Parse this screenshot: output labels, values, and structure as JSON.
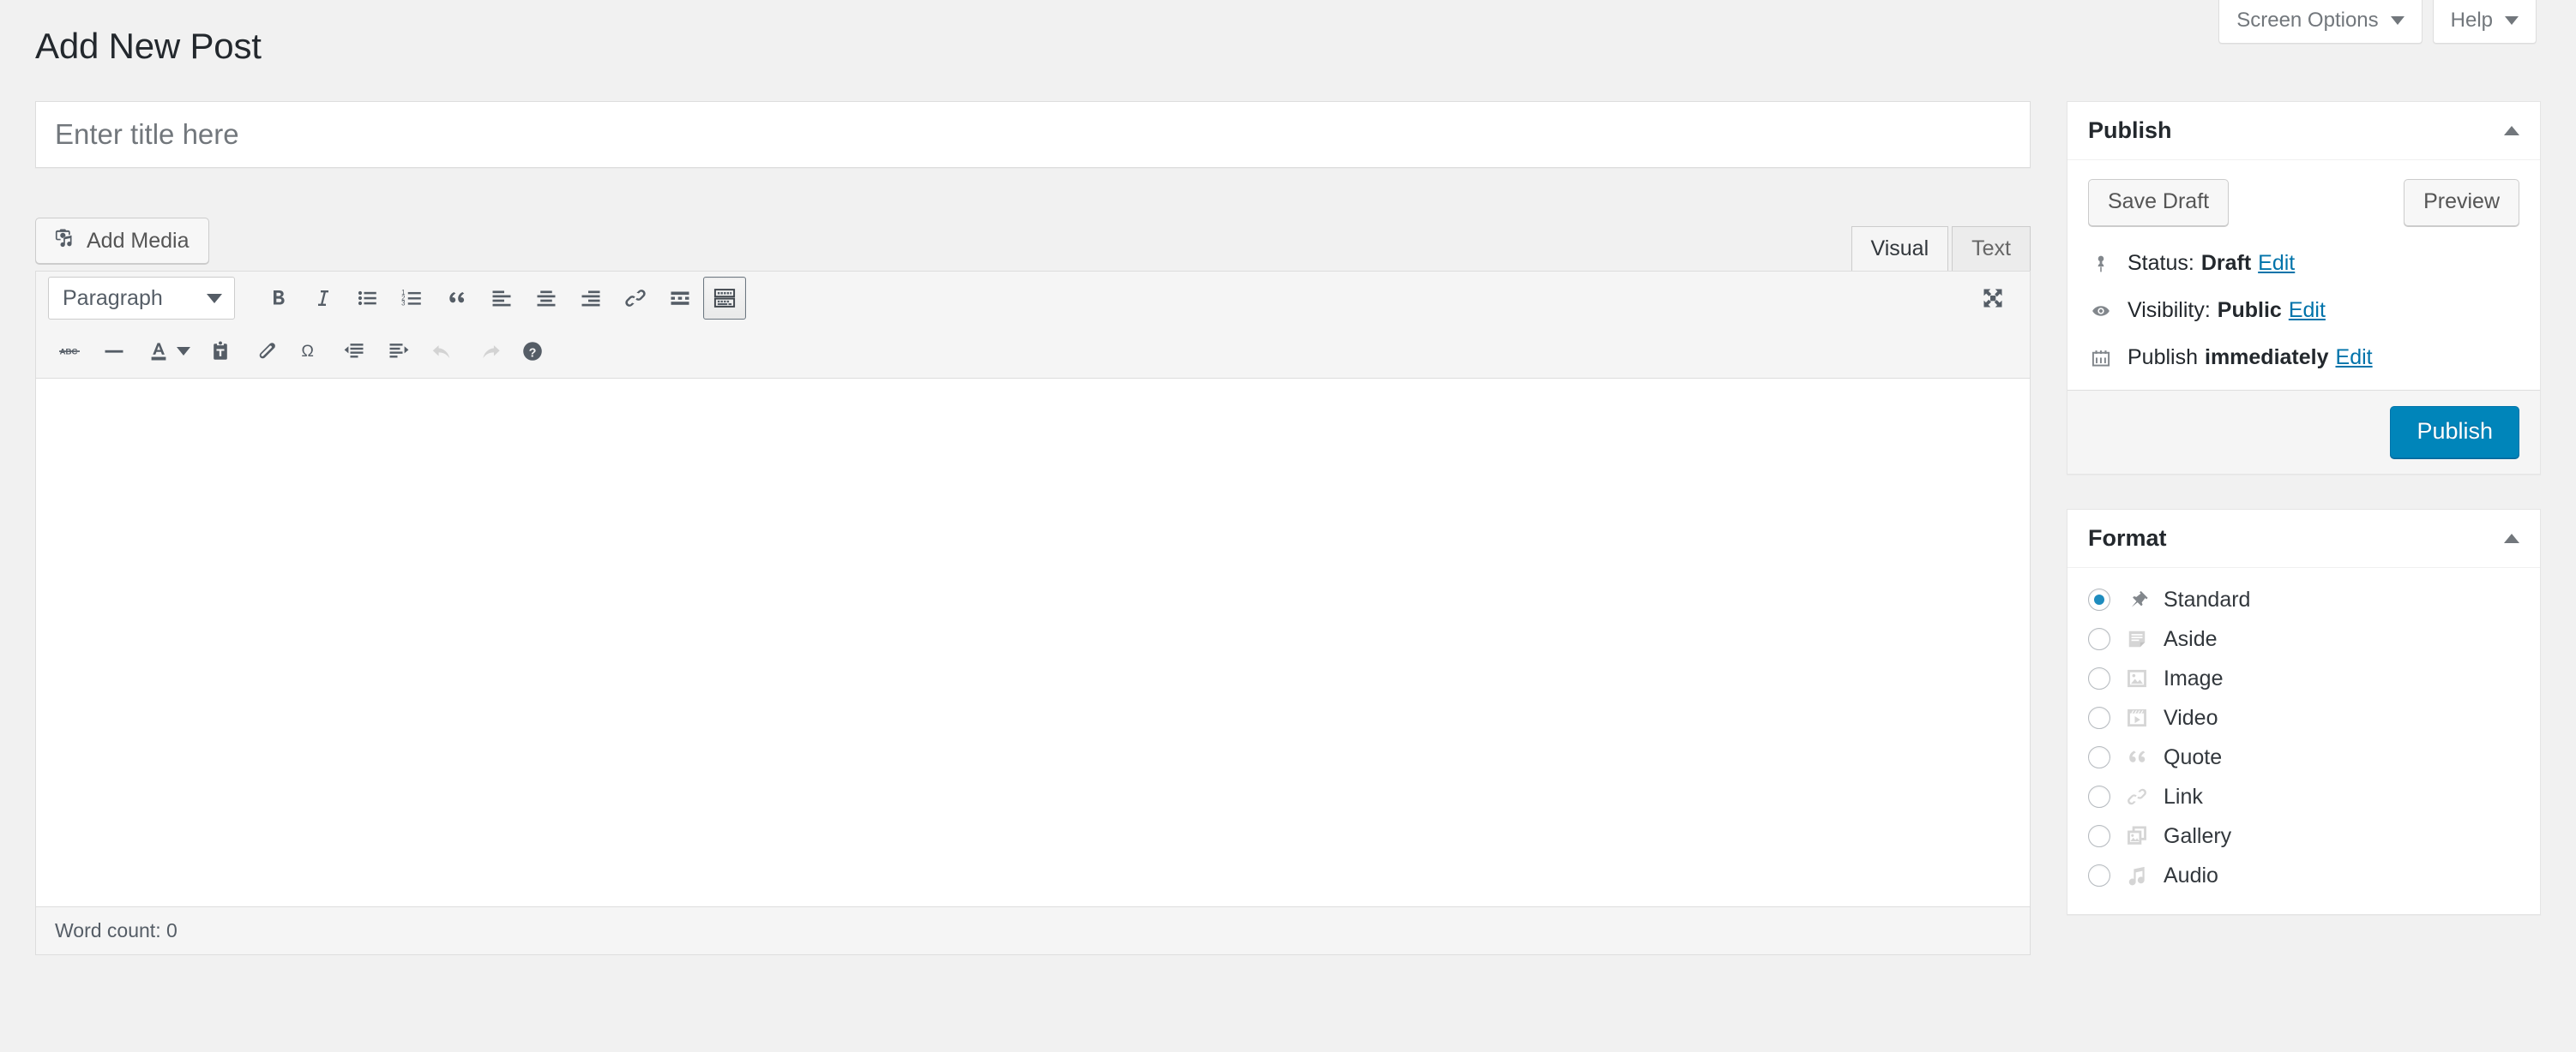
{
  "topbar": {
    "screen_options_label": "Screen Options",
    "help_label": "Help"
  },
  "page": {
    "title": "Add New Post"
  },
  "title_field": {
    "value": "",
    "placeholder": "Enter title here"
  },
  "editor": {
    "add_media_label": "Add Media",
    "tabs": [
      {
        "label": "Visual",
        "active": true
      },
      {
        "label": "Text",
        "active": false
      }
    ],
    "format_select_value": "Paragraph",
    "toolbar_row1": [
      {
        "name": "bold-icon",
        "title": "Bold"
      },
      {
        "name": "italic-icon",
        "title": "Italic"
      },
      {
        "name": "bullet-list-icon",
        "title": "Bulleted list"
      },
      {
        "name": "numbered-list-icon",
        "title": "Numbered list"
      },
      {
        "name": "blockquote-icon",
        "title": "Blockquote"
      },
      {
        "name": "align-left-icon",
        "title": "Align left"
      },
      {
        "name": "align-center-icon",
        "title": "Align center"
      },
      {
        "name": "align-right-icon",
        "title": "Align right"
      },
      {
        "name": "link-icon",
        "title": "Insert/edit link"
      },
      {
        "name": "read-more-icon",
        "title": "Insert Read More tag"
      },
      {
        "name": "toolbar-toggle-icon",
        "title": "Toolbar Toggle"
      }
    ],
    "toolbar_row2": [
      {
        "name": "strikethrough-icon",
        "title": "Strikethrough"
      },
      {
        "name": "horizontal-rule-icon",
        "title": "Horizontal line"
      },
      {
        "name": "text-color-icon",
        "title": "Text color"
      },
      {
        "name": "paste-as-text-icon",
        "title": "Paste as text"
      },
      {
        "name": "clear-formatting-icon",
        "title": "Clear formatting"
      },
      {
        "name": "special-character-icon",
        "title": "Special character"
      },
      {
        "name": "outdent-icon",
        "title": "Decrease indent"
      },
      {
        "name": "indent-icon",
        "title": "Increase indent"
      },
      {
        "name": "undo-icon",
        "title": "Undo"
      },
      {
        "name": "redo-icon",
        "title": "Redo"
      },
      {
        "name": "keyboard-shortcuts-icon",
        "title": "Keyboard Shortcuts"
      }
    ],
    "fullscreen_icon": "distraction-free-writing-icon",
    "content": "",
    "word_count_text": "Word count: 0"
  },
  "publish_box": {
    "title": "Publish",
    "save_draft_label": "Save Draft",
    "preview_label": "Preview",
    "status_label": "Status:",
    "status_value": "Draft",
    "status_edit": "Edit",
    "visibility_label": "Visibility:",
    "visibility_value": "Public",
    "visibility_edit": "Edit",
    "publish_label": "Publish",
    "publish_value": "immediately",
    "publish_edit": "Edit",
    "publish_button_label": "Publish"
  },
  "format_box": {
    "title": "Format",
    "options": [
      {
        "label": "Standard",
        "icon": "pin-icon",
        "selected": true
      },
      {
        "label": "Aside",
        "icon": "aside-icon",
        "selected": false
      },
      {
        "label": "Image",
        "icon": "image-icon",
        "selected": false
      },
      {
        "label": "Video",
        "icon": "video-icon",
        "selected": false
      },
      {
        "label": "Quote",
        "icon": "quote-icon",
        "selected": false
      },
      {
        "label": "Link",
        "icon": "link-icon",
        "selected": false
      },
      {
        "label": "Gallery",
        "icon": "gallery-icon",
        "selected": false
      },
      {
        "label": "Audio",
        "icon": "audio-icon",
        "selected": false
      }
    ]
  },
  "colors": {
    "page_background": "#f1f1f1",
    "primary_button": "#0085ba",
    "link": "#0073aa",
    "radio_selected": "#1e8cbe",
    "icon": "#555d66",
    "icon_muted": "#cccccc"
  }
}
